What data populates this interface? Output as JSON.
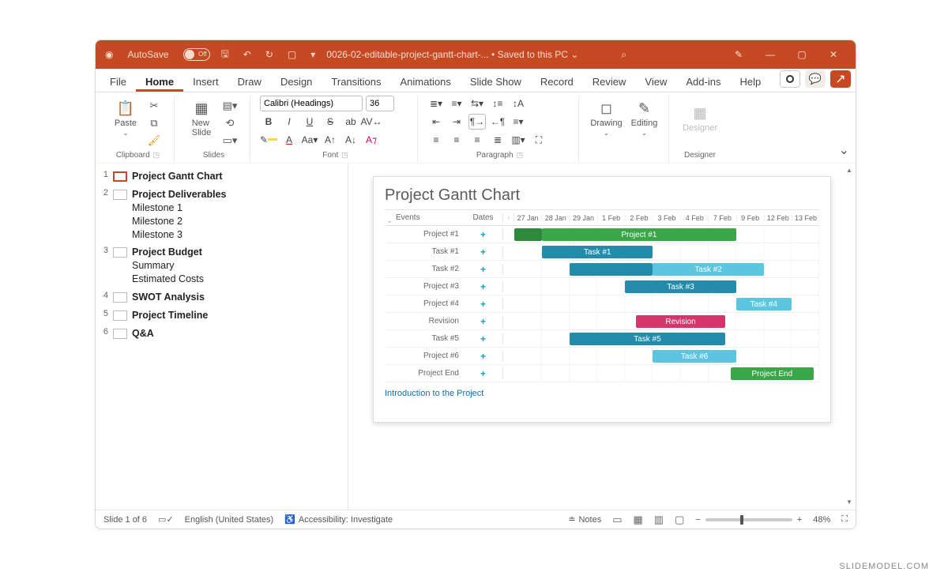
{
  "titlebar": {
    "autosave_label": "AutoSave",
    "autosave_state": "Off",
    "doc_title": "0026-02-editable-project-gantt-chart-...",
    "save_status": "Saved to this PC"
  },
  "tabs": [
    "File",
    "Home",
    "Insert",
    "Draw",
    "Design",
    "Transitions",
    "Animations",
    "Slide Show",
    "Record",
    "Review",
    "View",
    "Add-ins",
    "Help"
  ],
  "active_tab": "Home",
  "ribbon": {
    "groups": {
      "clipboard": {
        "label": "Clipboard",
        "paste": "Paste"
      },
      "slides": {
        "label": "Slides",
        "new_slide": "New\nSlide"
      },
      "font": {
        "label": "Font",
        "name": "Calibri (Headings)",
        "size": "36"
      },
      "paragraph": {
        "label": "Paragraph"
      },
      "drawing": {
        "label": "",
        "drawing": "Drawing",
        "editing": "Editing"
      },
      "designer": {
        "label": "Designer",
        "btn": "Designer"
      }
    }
  },
  "outline": [
    {
      "n": "1",
      "selected": true,
      "lines": [
        "Project Gantt Chart"
      ]
    },
    {
      "n": "2",
      "lines": [
        "Project Deliverables",
        "Milestone 1",
        "Milestone 2",
        "Milestone 3"
      ]
    },
    {
      "n": "3",
      "lines": [
        "Project Budget",
        "Summary",
        "Estimated Costs"
      ]
    },
    {
      "n": "4",
      "lines": [
        "SWOT Analysis"
      ]
    },
    {
      "n": "5",
      "lines": [
        "Project Timeline"
      ]
    },
    {
      "n": "6",
      "lines": [
        "Q&A"
      ]
    }
  ],
  "slide": {
    "title": "Project Gantt Chart",
    "subtitle": "Introduction to the Project",
    "headers": {
      "events": "Events",
      "dates": "Dates"
    },
    "dates": [
      "27 Jan",
      "28 Jan",
      "29 Jan",
      "1 Feb",
      "2 Feb",
      "3 Feb",
      "4 Feb",
      "7 Feb",
      "9 Feb",
      "12 Feb",
      "13 Feb"
    ],
    "rows": [
      {
        "name": "Project #1",
        "bars": [
          {
            "label": "",
            "start": 0,
            "span": 1,
            "color": "#2c8a3a"
          },
          {
            "label": "Project #1",
            "start": 1,
            "span": 7,
            "color": "#3aa648"
          }
        ]
      },
      {
        "name": "Task #1",
        "bars": [
          {
            "label": "Task #1",
            "start": 1,
            "span": 4,
            "color": "#238caa"
          }
        ]
      },
      {
        "name": "Task #2",
        "bars": [
          {
            "label": "",
            "start": 2,
            "span": 3,
            "color": "#238caa"
          },
          {
            "label": "Task #2",
            "start": 5,
            "span": 4,
            "color": "#5cc6e0"
          }
        ]
      },
      {
        "name": "Project #3",
        "bars": [
          {
            "label": "Task #3",
            "start": 4,
            "span": 4,
            "color": "#238caa"
          }
        ]
      },
      {
        "name": "Project #4",
        "bars": [
          {
            "label": "Task #4",
            "start": 8,
            "span": 2,
            "color": "#5cc6e0"
          }
        ]
      },
      {
        "name": "Revision",
        "bars": [
          {
            "label": "Revision",
            "start": 4.4,
            "span": 3.2,
            "color": "#d4366b"
          }
        ]
      },
      {
        "name": "Task #5",
        "bars": [
          {
            "label": "Task #5",
            "start": 2,
            "span": 5.6,
            "color": "#238caa"
          }
        ]
      },
      {
        "name": "Project #6",
        "bars": [
          {
            "label": "Task #6",
            "start": 5,
            "span": 3,
            "color": "#5cc6e0"
          }
        ]
      },
      {
        "name": "Project End",
        "bars": [
          {
            "label": "Project End",
            "start": 7.8,
            "span": 3,
            "color": "#3aa648"
          }
        ]
      }
    ]
  },
  "status": {
    "slide": "Slide 1 of 6",
    "lang": "English (United States)",
    "access": "Accessibility: Investigate",
    "notes": "Notes",
    "zoom": "48%"
  },
  "chart_data": {
    "type": "bar",
    "title": "Project Gantt Chart",
    "xlabel": "Dates",
    "ylabel": "Events",
    "categories": [
      "27 Jan",
      "28 Jan",
      "29 Jan",
      "1 Feb",
      "2 Feb",
      "3 Feb",
      "4 Feb",
      "7 Feb",
      "9 Feb",
      "12 Feb",
      "13 Feb"
    ],
    "series": [
      {
        "name": "Project #1",
        "start": "27 Jan",
        "end": "9 Feb"
      },
      {
        "name": "Task #1",
        "start": "28 Jan",
        "end": "2 Feb"
      },
      {
        "name": "Task #2",
        "start": "29 Jan",
        "end": "9 Feb"
      },
      {
        "name": "Task #3",
        "start": "2 Feb",
        "end": "9 Feb"
      },
      {
        "name": "Task #4",
        "start": "9 Feb",
        "end": "13 Feb"
      },
      {
        "name": "Revision",
        "start": "2 Feb",
        "end": "7 Feb"
      },
      {
        "name": "Task #5",
        "start": "29 Jan",
        "end": "7 Feb"
      },
      {
        "name": "Task #6",
        "start": "3 Feb",
        "end": "9 Feb"
      },
      {
        "name": "Project End",
        "start": "7 Feb",
        "end": "13 Feb"
      }
    ]
  },
  "watermark": "SLIDEMODEL.COM"
}
